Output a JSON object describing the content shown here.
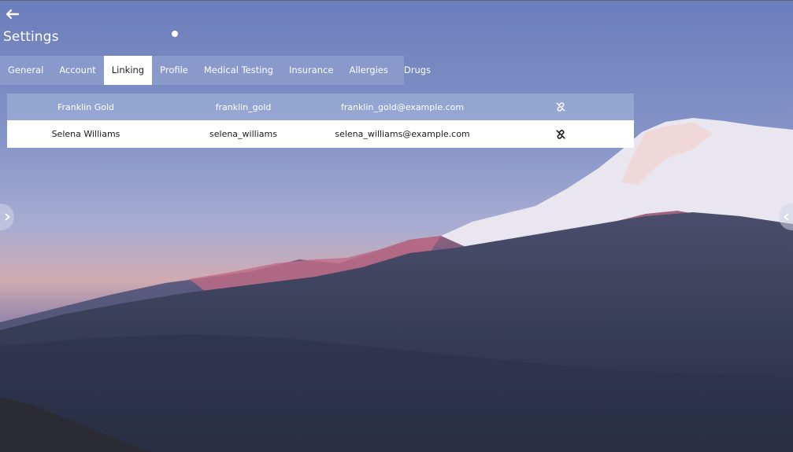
{
  "header": {
    "back_icon": "arrow-left-icon",
    "title": "Settings"
  },
  "tabs": [
    {
      "label": "General",
      "active": false
    },
    {
      "label": "Account",
      "active": false
    },
    {
      "label": "Linking",
      "active": true
    },
    {
      "label": "Profile",
      "active": false
    },
    {
      "label": "Medical Testing",
      "active": false
    },
    {
      "label": "Insurance",
      "active": false
    },
    {
      "label": "Allergies",
      "active": false
    },
    {
      "label": "Drugs",
      "active": false
    }
  ],
  "linked_accounts": [
    {
      "name": "Franklin Gold",
      "username": "franklin_gold",
      "email": "franklin_gold@example.com",
      "action_icon": "unlink-icon"
    },
    {
      "name": "Selena Williams",
      "username": "selena_williams",
      "email": "selena_williams@example.com",
      "action_icon": "unlink-icon"
    }
  ],
  "navigation": {
    "prev_icon": "chevron-right-icon",
    "next_icon": "chevron-left-icon"
  },
  "colors": {
    "tab_bar": "#8c9ccd",
    "active_tab": "#ffffff",
    "row_highlight": "#ffffff"
  }
}
